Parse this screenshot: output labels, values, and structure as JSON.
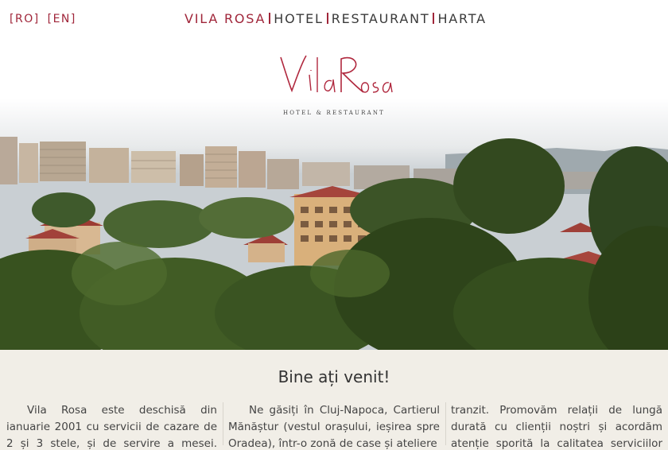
{
  "languages": [
    "[RO]",
    "[EN]"
  ],
  "nav": {
    "brand": "VILA ROSA",
    "items": [
      "HOTEL",
      "RESTAURANT",
      "HARTA"
    ]
  },
  "logo": {
    "script_text": "Vila Rosa",
    "subtitle": "HOTEL & RESTAURANT"
  },
  "welcome": {
    "title": "Bine ați venit!",
    "col1": "Vila Rosa este deschisă din ianuarie 2001 cu servicii de cazare de 2 și 3 stele, și de servire a mesei. Activitatea de cazare se",
    "col2": "Ne găsiți în Cluj-Napoca, Cartierul Mănăștur (vestul orașului, ieșirea spre Oradea), într-o zonă de case și ateliere",
    "col3": "tranzit. Promovăm relații de lungă durată cu clienții noștri și acordăm atenție sporită la calitatea serviciilor oferite. De"
  },
  "colors": {
    "accent": "#a0263a",
    "background": "#f1eee7"
  }
}
